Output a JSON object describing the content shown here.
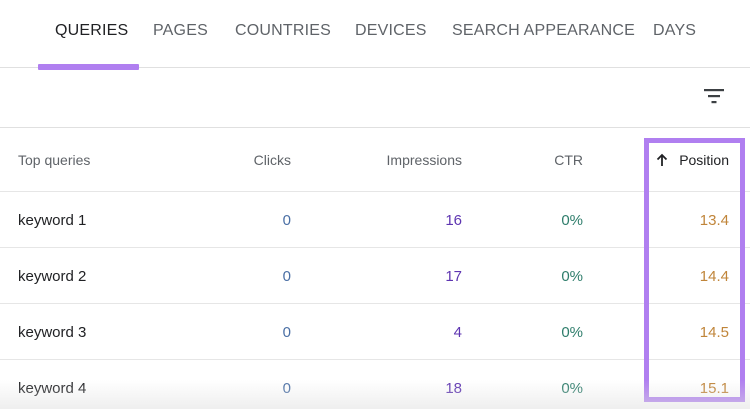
{
  "tabs": [
    {
      "label": "QUERIES",
      "active": true
    },
    {
      "label": "PAGES",
      "active": false
    },
    {
      "label": "COUNTRIES",
      "active": false
    },
    {
      "label": "DEVICES",
      "active": false
    },
    {
      "label": "SEARCH APPEARANCE",
      "active": false
    },
    {
      "label": "DAYS",
      "active": false
    }
  ],
  "toolbar": {
    "filter_icon": "filter-icon"
  },
  "table": {
    "columns": {
      "query": "Top queries",
      "clicks": "Clicks",
      "impressions": "Impressions",
      "ctr": "CTR",
      "position": "Position"
    },
    "sort": {
      "column": "position",
      "direction": "ascending",
      "icon": "arrow-up-icon"
    },
    "rows": [
      {
        "query": "keyword 1",
        "clicks": "0",
        "impressions": "16",
        "ctr": "0%",
        "position": "13.4"
      },
      {
        "query": "keyword 2",
        "clicks": "0",
        "impressions": "17",
        "ctr": "0%",
        "position": "14.4"
      },
      {
        "query": "keyword 3",
        "clicks": "0",
        "impressions": "4",
        "ctr": "0%",
        "position": "14.5"
      },
      {
        "query": "keyword 4",
        "clicks": "0",
        "impressions": "18",
        "ctr": "0%",
        "position": "15.1"
      }
    ]
  },
  "colors": {
    "accent": "#b07ff0",
    "clicks": "#4a6fa5",
    "impressions": "#5e35b1",
    "ctr": "#2e7d6b",
    "position": "#c0853a"
  }
}
